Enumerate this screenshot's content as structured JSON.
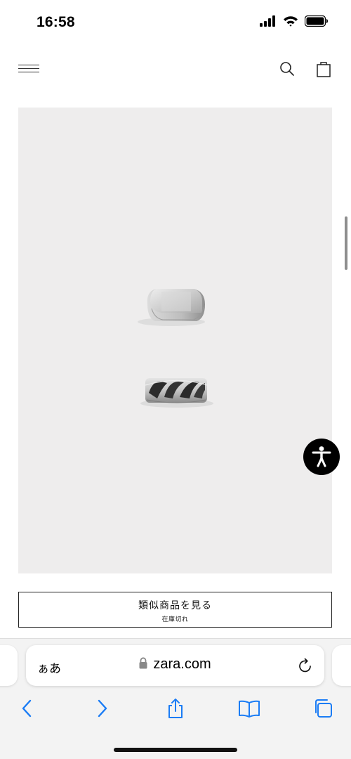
{
  "status_bar": {
    "time": "16:58",
    "icons": [
      "cellular-signal-icon",
      "wifi-icon",
      "battery-icon"
    ]
  },
  "header": {
    "icons": [
      "hamburger-menu-icon",
      "search-icon",
      "shopping-bag-icon"
    ]
  },
  "product": {
    "background_color": "#eeeded",
    "images": [
      "signet-ring",
      "chain-link-ring"
    ]
  },
  "similar_button": {
    "label": "類似商品を見る",
    "sublabel": "在庫切れ"
  },
  "accessibility_button": {
    "icon": "accessibility-icon",
    "color": "#000000"
  },
  "browser": {
    "text_size_label": "ぁあ",
    "url": "zara.com",
    "toolbar_icons": [
      "back-icon",
      "forward-icon",
      "share-icon",
      "bookmarks-icon",
      "tabs-icon"
    ],
    "accent_color": "#1a7cf5"
  }
}
